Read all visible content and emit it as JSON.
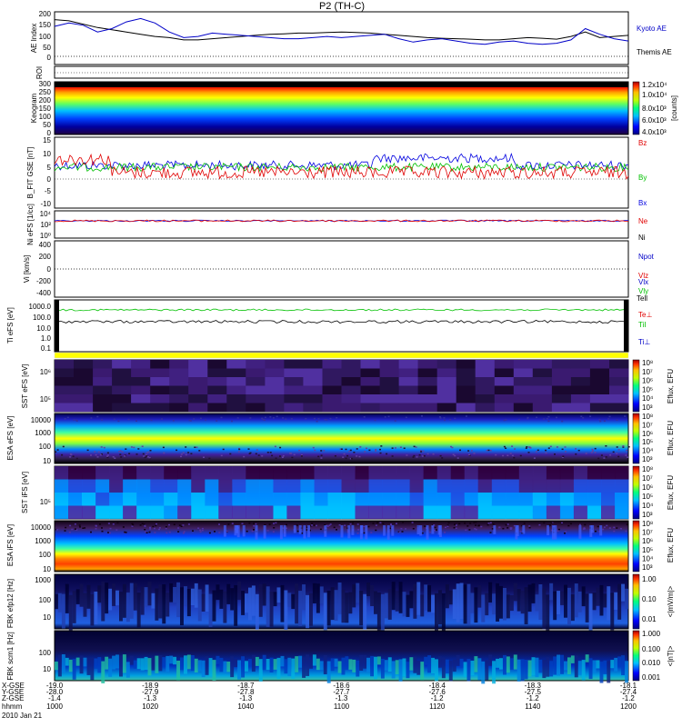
{
  "title": "P2 (TH-C)",
  "footer": {
    "row_labels": [
      "X-GSE",
      "Y-GSE",
      "Z-GSE",
      "hhmm",
      "2010 Jan 21"
    ],
    "columns": [
      {
        "x": "-19.0",
        "y": "-28.0",
        "z": "-1.4",
        "t": "1000"
      },
      {
        "x": "-18.9",
        "y": "-27.9",
        "z": "-1.3",
        "t": "1020"
      },
      {
        "x": "-18.7",
        "y": "-27.8",
        "z": "-1.3",
        "t": "1040"
      },
      {
        "x": "-18.6",
        "y": "-27.7",
        "z": "-1.3",
        "t": "1100"
      },
      {
        "x": "-18.4",
        "y": "-27.6",
        "z": "-1.2",
        "t": "1120"
      },
      {
        "x": "-18.3",
        "y": "-27.5",
        "z": "-1.2",
        "t": "1140"
      },
      {
        "x": "-18.1",
        "y": "-27.4",
        "z": "-1.2",
        "t": "1200"
      }
    ]
  },
  "colors": {
    "kyoto": "#0000c8",
    "themis": "#000000",
    "red": "#e00000",
    "green": "#00c000",
    "blue": "#0000e0",
    "yellow": "#ffff00"
  },
  "chart_data": [
    {
      "type": "line",
      "ylabel": "AE Index",
      "yticks": [
        "200",
        "150",
        "100",
        "50",
        "0"
      ],
      "ylim": [
        -25,
        210
      ],
      "x_range": [
        "1000",
        "1200"
      ],
      "series": [
        {
          "name": "Kyoto AE",
          "values": [
            145,
            160,
            150,
            120,
            135,
            165,
            180,
            160,
            120,
            95,
            100,
            115,
            110,
            105,
            100,
            95,
            90,
            90,
            95,
            100,
            95,
            100,
            105,
            110,
            90,
            75,
            85,
            90,
            80,
            70,
            65,
            75,
            80,
            70,
            65,
            70,
            85,
            135,
            110,
            90,
            80
          ]
        },
        {
          "name": "Themis AE",
          "values": [
            175,
            170,
            155,
            140,
            130,
            120,
            110,
            100,
            95,
            85,
            85,
            90,
            95,
            100,
            105,
            110,
            112,
            115,
            115,
            118,
            120,
            118,
            115,
            110,
            105,
            100,
            95,
            92,
            90,
            88,
            85,
            85,
            90,
            95,
            92,
            88,
            100,
            120,
            95,
            100,
            105
          ]
        }
      ]
    },
    {
      "type": "line",
      "ylabel": "ROI",
      "series": []
    },
    {
      "type": "heatmap",
      "ylabel": "Keogram",
      "yticks": [
        "300",
        "250",
        "200",
        "150",
        "100",
        "50",
        "0"
      ],
      "ylim": [
        0,
        300
      ],
      "colorbar_ticks": [
        "1.2x10⁴",
        "1.0x10⁴",
        "8.0x10³",
        "6.0x10³",
        "4.0x10³"
      ],
      "colorbar_label": "[counts]"
    },
    {
      "type": "line",
      "ylabel": "B_FIT GSE [nT]",
      "yticks": [
        "15",
        "10",
        "5",
        "0",
        "-5",
        "-10"
      ],
      "ylim": [
        -10,
        15
      ],
      "series": [
        {
          "name": "Bz"
        },
        {
          "name": "By"
        },
        {
          "name": "Bx"
        }
      ]
    },
    {
      "type": "line",
      "ylabel": "Ni eFS [1/cc]",
      "yticks": [
        "10⁴",
        "10²",
        "10⁰",
        "10⁻²"
      ],
      "series": [
        {
          "name": "Ne"
        },
        {
          "name": "Ni"
        },
        {
          "name": "Npot"
        }
      ]
    },
    {
      "type": "line",
      "ylabel": "Vi [km/s]",
      "yticks": [
        "400",
        "200",
        "0",
        "-200",
        "-400"
      ],
      "ylim": [
        -500,
        500
      ],
      "series": [
        {
          "name": "Vlz"
        },
        {
          "name": "Vly"
        },
        {
          "name": "Vlx"
        }
      ]
    },
    {
      "type": "line",
      "ylabel": "Ti eFS [eV]",
      "yticks": [
        "1000.0",
        "100.0",
        "10.0",
        "1.0",
        "0.1"
      ],
      "series": [
        {
          "name": "Tell"
        },
        {
          "name": "Te⊥"
        },
        {
          "name": "TiI"
        },
        {
          "name": "Ti⊥"
        }
      ]
    },
    {
      "type": "heatmap",
      "ylabel": "SST eFS [eV]",
      "yticks": [
        "10⁶",
        "10⁵"
      ],
      "colorbar_label": "Eflux, EFU"
    },
    {
      "type": "heatmap",
      "ylabel": "ESA eFS [eV]",
      "yticks": [
        "10000",
        "1000",
        "100",
        "10"
      ],
      "colorbar_label": "Eflux, EFU"
    },
    {
      "type": "heatmap",
      "ylabel": "SST iFS [eV]",
      "yticks": [
        "10⁵"
      ],
      "colorbar_label": "Eflux, EFU"
    },
    {
      "type": "heatmap",
      "ylabel": "ESA iFS [eV]",
      "yticks": [
        "10000",
        "1000",
        "100",
        "10"
      ],
      "colorbar_label": "Eflux, EFU"
    },
    {
      "type": "heatmap",
      "ylabel": "FBK efp12 [Hz]",
      "yticks": [
        "1000",
        "100",
        "10"
      ],
      "colorbar_ticks": [
        "1.00",
        "0.10",
        "0.01"
      ],
      "colorbar_label": "<|mV/m|>"
    },
    {
      "type": "heatmap",
      "ylabel": "FBK scm1 [Hz]",
      "yticks": [
        "100",
        "10"
      ],
      "colorbar_ticks": [
        "1.000",
        "0.100",
        "0.010",
        "0.001"
      ],
      "colorbar_label": "<|nT|>"
    }
  ],
  "eflux_ticks": [
    "10⁸",
    "10⁷",
    "10⁶",
    "10⁵",
    "10⁴",
    "10³"
  ]
}
